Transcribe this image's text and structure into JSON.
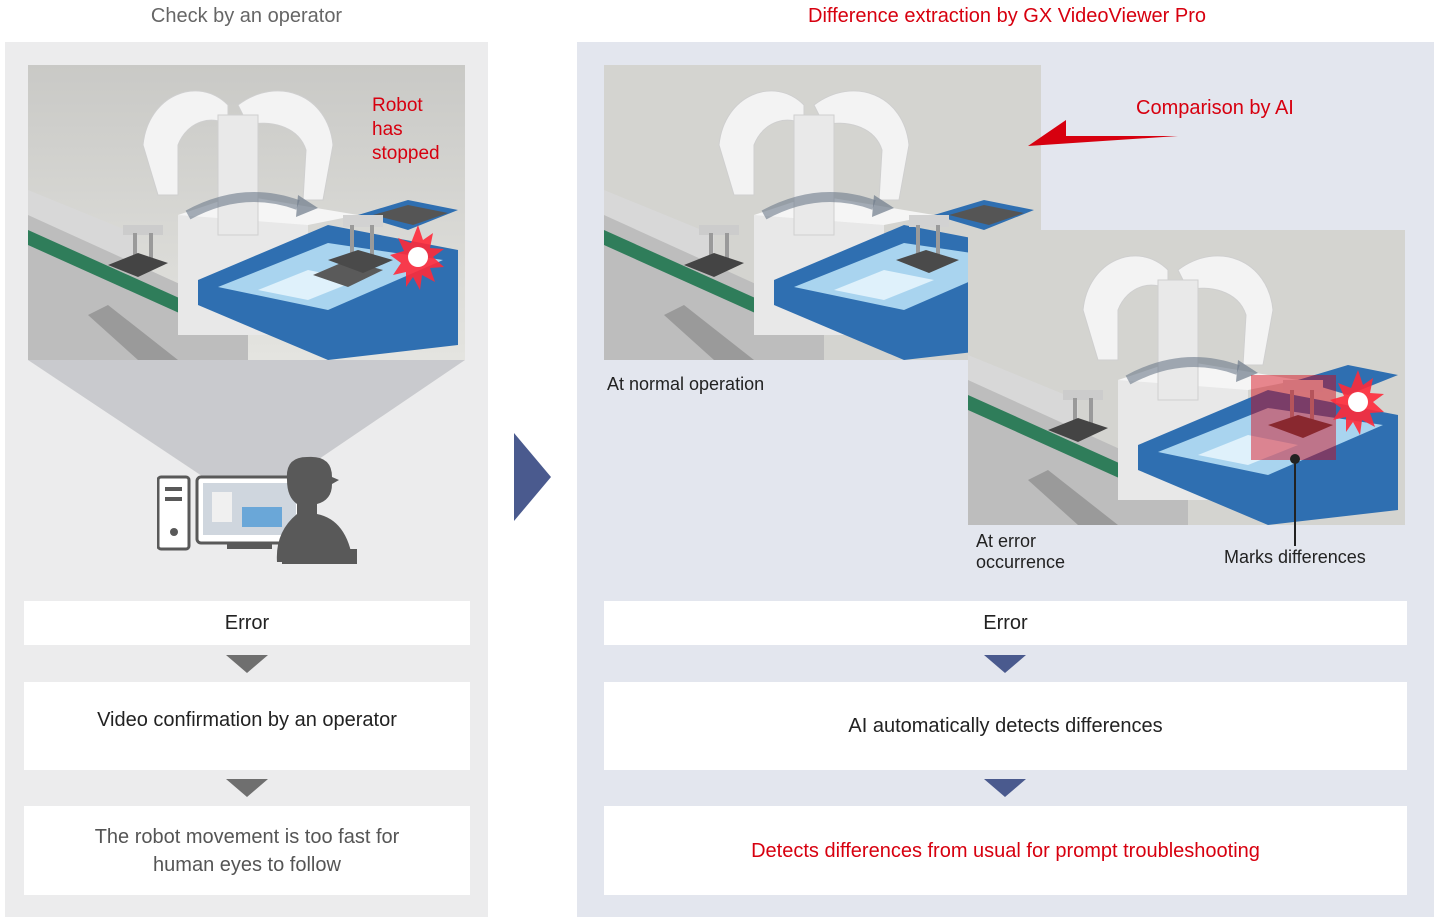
{
  "left": {
    "heading": "Check by an operator",
    "scene_note_lines": [
      "Robot",
      "has",
      "stopped"
    ],
    "step1": "Error",
    "step2": "Video confirmation by an operator",
    "step3_lines": [
      "The robot movement is too fast for",
      "human eyes to follow"
    ]
  },
  "right": {
    "heading": "Difference extraction by GX VideoViewer Pro",
    "comparison": "Comparison by AI",
    "normal_label": "At normal operation",
    "error_label_lines": [
      "At error",
      "occurrence"
    ],
    "marks_label": "Marks differences",
    "step1": "Error",
    "step2": "AI automatically detects differences",
    "step3": "Detects differences from usual for prompt troubleshooting"
  },
  "colors": {
    "accent_red": "#d7000f",
    "left_panel": "#ececed",
    "right_panel": "#e3e6ee",
    "left_arrow": "#6f6f6f",
    "right_arrow": "#4a5a8e",
    "container_blue": "#2f6fb1"
  }
}
